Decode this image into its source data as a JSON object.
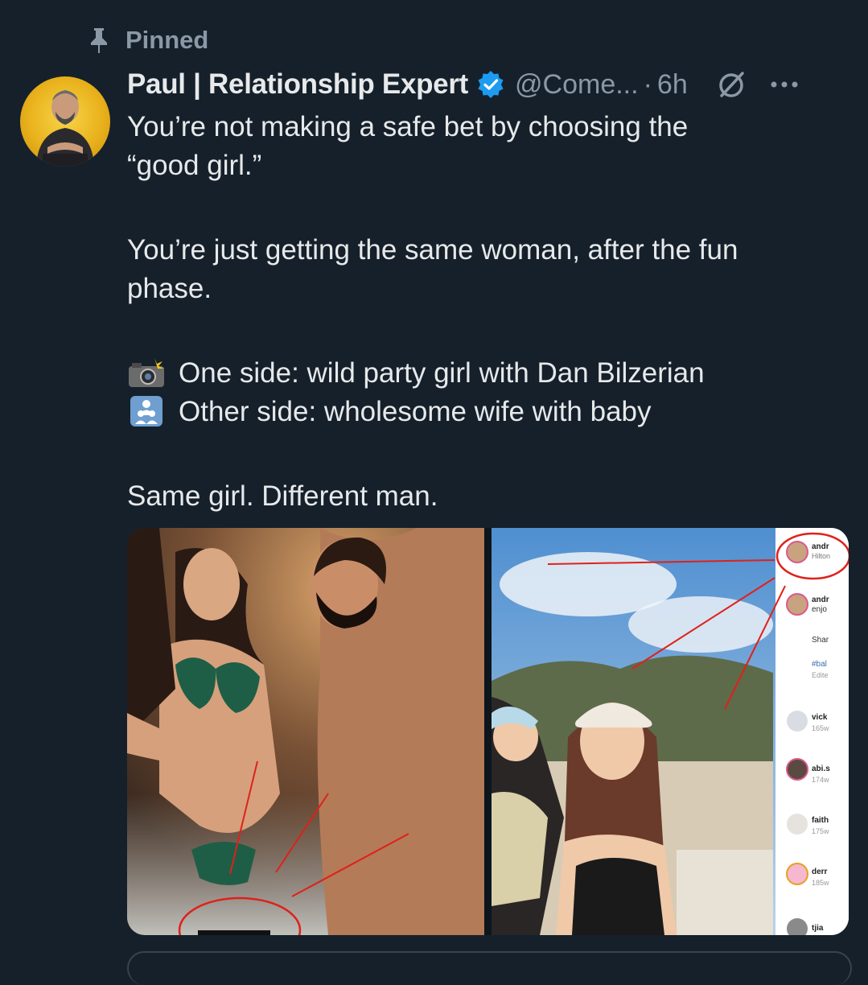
{
  "pinned": {
    "label": "Pinned",
    "icon": "pin-icon"
  },
  "author": {
    "display_name": "Paul | Relationship Expert",
    "handle": "@Come...",
    "separator": "·",
    "time": "6h",
    "verified_color": "#1d9bf0"
  },
  "tweet": {
    "line1a": "You’re not making a safe bet by choosing the",
    "line1b": "“good girl.”",
    "line2a": "You’re just getting the same woman, after the fun",
    "line2b": "phase.",
    "bullet1": "One side: wild party girl with Dan Bilzerian",
    "bullet2": "Other side: wholesome wife with baby",
    "closing": "Same girl. Different man."
  },
  "media": {
    "left_photo": "party-photo",
    "right_photo": "beach-photo",
    "sidebar_items": [
      {
        "name": "andr",
        "sub": "Hilton"
      },
      {
        "name": "andr",
        "sub": "enjo"
      },
      {
        "name": "Shar",
        "sub": ""
      },
      {
        "name": "#bal",
        "sub": "Edite"
      },
      {
        "name": "vick",
        "sub": "165w"
      },
      {
        "name": "abi.s",
        "sub": "174w"
      },
      {
        "name": "faith",
        "sub": "175w"
      },
      {
        "name": "derr",
        "sub": "185w"
      },
      {
        "name": "tjia",
        "sub": ""
      }
    ]
  },
  "colors": {
    "background": "#15202b",
    "text": "#e7e9ea",
    "muted": "#8b98a5",
    "accent": "#1d9bf0",
    "annotation": "#e0201a"
  }
}
